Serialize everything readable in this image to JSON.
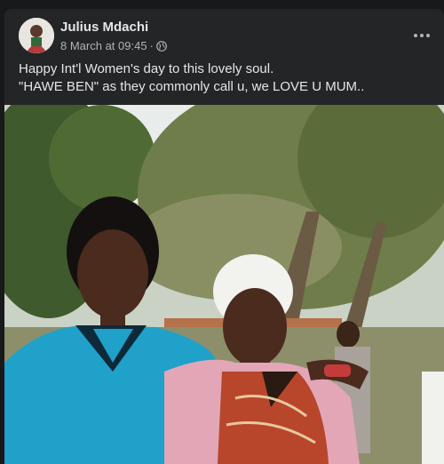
{
  "post": {
    "author": "Julius Mdachi",
    "timestamp": "8 March at 09:45",
    "separator": "·",
    "visibility_icon": "globe-icon",
    "options_icon": "more-options-icon",
    "caption_lines": [
      "Happy Int'l Women's day to this lovely soul.",
      "\"HAWE BEN\" as they commonly call u, we LOVE U MUM.."
    ]
  },
  "colors": {
    "page_bg": "#18191a",
    "card_bg": "#242526",
    "primary_text": "#e4e6eb",
    "secondary_text": "#b0b3b8"
  }
}
